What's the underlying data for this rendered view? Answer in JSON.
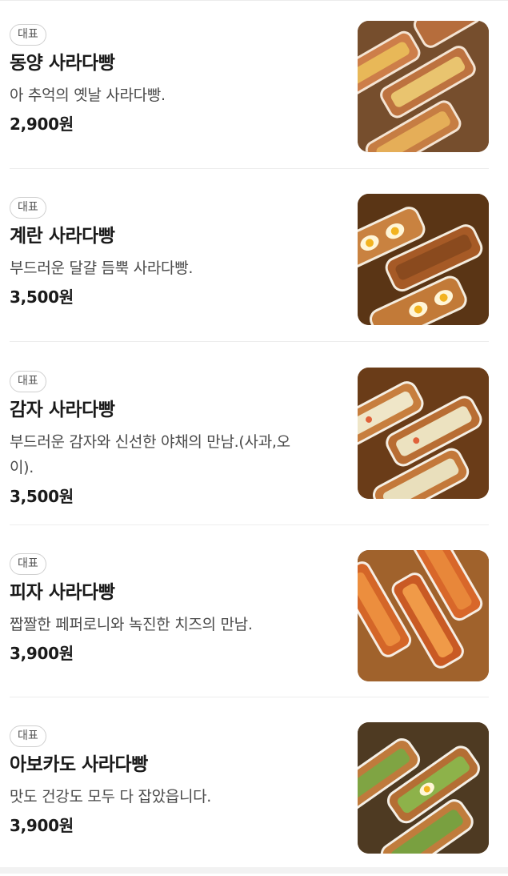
{
  "menu": {
    "items": [
      {
        "badge": "대표",
        "name": "동양 사라다빵",
        "description": "아 추억의 옛날 사라다빵.",
        "price": "2,900원",
        "photo_icon": "salad-bread-photo"
      },
      {
        "badge": "대표",
        "name": "계란 사라다빵",
        "description": "부드러운 달걀 듬뿍 사라다빵.",
        "price": "3,500원",
        "photo_icon": "egg-salad-bread-photo"
      },
      {
        "badge": "대표",
        "name": "감자 사라다빵",
        "description": "부드러운 감자와 신선한 야채의 만남.(사과,오이).",
        "description_line1": "부드러운 감자와 신선한 야채의 만남.(사과,오",
        "description_line2": "이).",
        "price": "3,500원",
        "photo_icon": "potato-salad-bread-photo"
      },
      {
        "badge": "대표",
        "name": "피자 사라다빵",
        "description": "짭짤한 페퍼로니와 녹진한 치즈의 만남.",
        "price": "3,900원",
        "photo_icon": "pizza-salad-bread-photo"
      },
      {
        "badge": "대표",
        "name": "아보카도 사라다빵",
        "description": "맛도 건강도 모두 다 잡았읍니다.",
        "price": "3,900원",
        "photo_icon": "avocado-salad-bread-photo"
      }
    ]
  },
  "colors": {
    "text_primary": "#1a1a1a",
    "text_secondary": "#4a4a4a",
    "badge_border": "#cfcfcf",
    "divider": "#ededed"
  }
}
